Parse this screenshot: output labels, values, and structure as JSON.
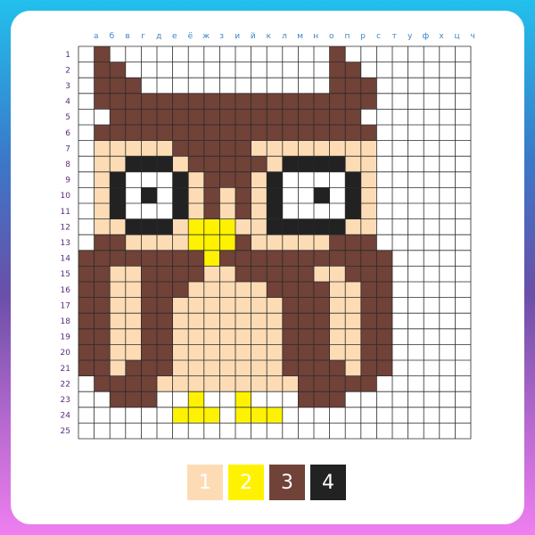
{
  "board": {
    "columns": [
      "а",
      "б",
      "в",
      "г",
      "д",
      "е",
      "ё",
      "ж",
      "з",
      "и",
      "й",
      "к",
      "л",
      "м",
      "н",
      "о",
      "п",
      "р",
      "с",
      "т",
      "у",
      "ф",
      "х",
      "ц",
      "ч"
    ],
    "rows": [
      "1",
      "2",
      "3",
      "4",
      "5",
      "6",
      "7",
      "8",
      "9",
      "10",
      "11",
      "12",
      "13",
      "14",
      "15",
      "16",
      "17",
      "18",
      "19",
      "20",
      "21",
      "22",
      "23",
      "24",
      "25"
    ],
    "cells": [
      "0300000000000000300000000",
      "0330000000000000330000000",
      "0333000000000000333000000",
      "0333333333333333333000000",
      "0033333333333333330000000",
      "0333333333333333333000000",
      "0111113333311111111000000",
      "0114441333331444411000000",
      "0140004133314000041000000",
      "0140404131314004041000000",
      "0140004131314000041000000",
      "0114441222114444411000000",
      "0331111222311111333000000",
      "3333333323333333333300000",
      "3311333311333331133300000",
      "3311333111113333113300000",
      "3311331111111333113300000",
      "3311331111111333113300000",
      "3311331111111333113300000",
      "3311331111111333113300000",
      "3313331111111333313300000",
      "0333311111111133333000000",
      "0033300200200033300000000",
      "0000002220222000000000000",
      "0000000000000000000000000"
    ]
  },
  "palette": [
    {
      "number": "1",
      "color": "#fddcb5"
    },
    {
      "number": "2",
      "color": "#fff200"
    },
    {
      "number": "3",
      "color": "#704238"
    },
    {
      "number": "4",
      "color": "#222222"
    }
  ],
  "colors": {
    "empty": "#ffffff",
    "grid_line": "#2a2a2a"
  }
}
